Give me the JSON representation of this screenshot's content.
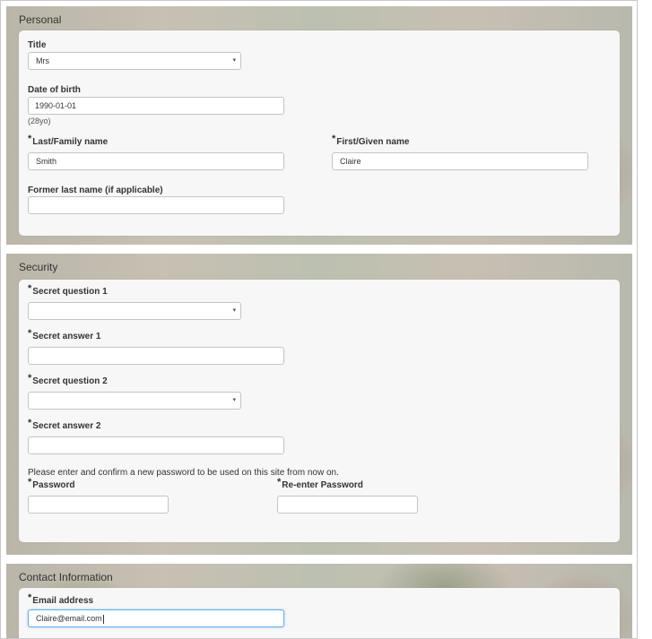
{
  "personal": {
    "section_title": "Personal",
    "title_label": "Title",
    "title_value": "Mrs",
    "dob_label": "Date of birth",
    "dob_value": "1990-01-01",
    "age_hint": "(28yo)",
    "last_name_label": "Last/Family name",
    "last_name_value": "Smith",
    "first_name_label": "First/Given name",
    "first_name_value": "Claire",
    "former_name_label": "Former last name (if applicable)",
    "former_name_value": ""
  },
  "security": {
    "section_title": "Security",
    "q1_label": "Secret question 1",
    "q1_value": "",
    "a1_label": "Secret answer 1",
    "a1_value": "",
    "q2_label": "Secret question 2",
    "q2_value": "",
    "a2_label": "Secret answer 2",
    "a2_value": "",
    "password_note": "Please enter and confirm a new password to be used on this site from now on.",
    "password_label": "Password",
    "reenter_label": "Re-enter Password"
  },
  "contact": {
    "section_title": "Contact Information",
    "email_label": "Email address",
    "email_value": "Claire@email.com"
  },
  "required_marker": "*",
  "icons": {
    "dropdown": "chevron-down-icon"
  }
}
